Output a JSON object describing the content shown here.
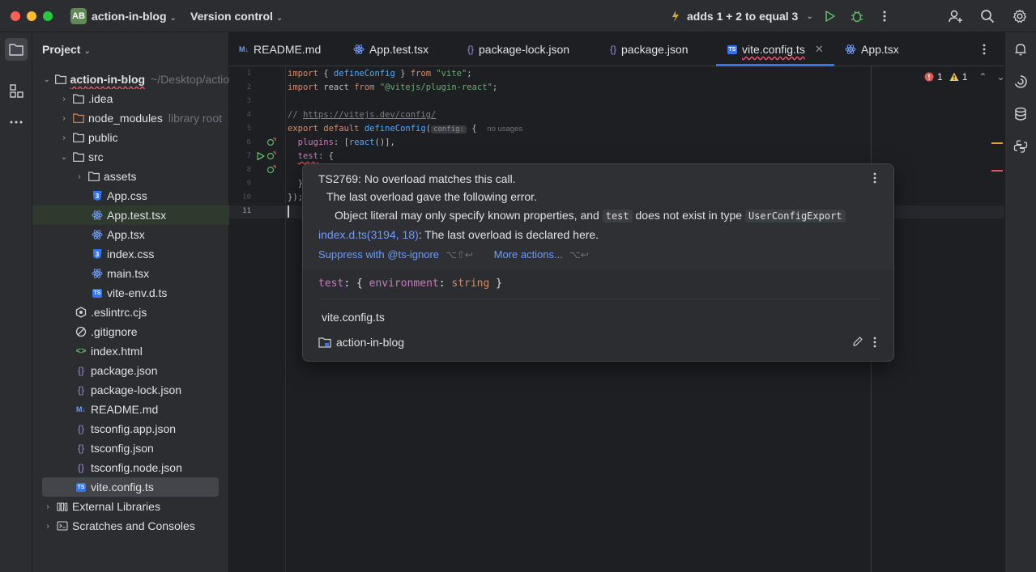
{
  "titlebar": {
    "project_badge": "AB",
    "project_name": "action-in-blog",
    "vcs_label": "Version control",
    "run_config": "adds 1 + 2 to equal 3"
  },
  "project_panel": {
    "title": "Project",
    "root_name": "action-in-blog",
    "root_path": "~/Desktop/actio",
    "items": [
      {
        "label": "action-in-blog"
      },
      {
        "label": ".idea"
      },
      {
        "label": "node_modules",
        "extra": "library root"
      },
      {
        "label": "public"
      },
      {
        "label": "src"
      },
      {
        "label": "assets"
      },
      {
        "label": "App.css"
      },
      {
        "label": "App.test.tsx"
      },
      {
        "label": "App.tsx"
      },
      {
        "label": "index.css"
      },
      {
        "label": "main.tsx"
      },
      {
        "label": "vite-env.d.ts"
      },
      {
        "label": ".eslintrc.cjs"
      },
      {
        "label": ".gitignore"
      },
      {
        "label": "index.html"
      },
      {
        "label": "package.json"
      },
      {
        "label": "package-lock.json"
      },
      {
        "label": "README.md"
      },
      {
        "label": "tsconfig.app.json"
      },
      {
        "label": "tsconfig.json"
      },
      {
        "label": "tsconfig.node.json"
      },
      {
        "label": "vite.config.ts"
      },
      {
        "label": "External Libraries"
      },
      {
        "label": "Scratches and Consoles"
      }
    ]
  },
  "tabs": [
    {
      "label": "README.md"
    },
    {
      "label": "App.test.tsx"
    },
    {
      "label": "package-lock.json"
    },
    {
      "label": "package.json"
    },
    {
      "label": "vite.config.ts"
    },
    {
      "label": "App.tsx"
    }
  ],
  "editor": {
    "line_numbers": [
      "1",
      "2",
      "3",
      "4",
      "5",
      "6",
      "7",
      "8",
      "9",
      "10",
      "11"
    ],
    "code": {
      "l1_kw": "import",
      "l1_a": " { ",
      "l1_fn": "defineConfig",
      "l1_b": " } ",
      "l1_kw2": "from",
      "l1_str": " \"vite\"",
      "l1_c": ";",
      "l2_kw": "import",
      "l2_a": " react ",
      "l2_kw2": "from",
      "l2_str": " \"@vitejs/plugin-react\"",
      "l2_c": ";",
      "l4_cmt": "// ",
      "l4_url": "https://vitejs.dev/config/",
      "l5_kw": "export default",
      "l5_fn": " defineConfig",
      "l5_a": "(",
      "l5_hint": "config:",
      "l5_b": " {",
      "l5_usages": "no usages",
      "l6_prop": "plugins",
      "l6_a": ": [",
      "l6_fn": "react",
      "l6_b": "()],",
      "l7_prop": "test",
      "l7_a": ": {",
      "l9": "}",
      "l10": "});"
    },
    "inspection": {
      "errors": "1",
      "warnings": "1"
    }
  },
  "popup": {
    "error_title": "TS2769: No overload matches this call.",
    "line2": "The last overload gave the following error.",
    "line3_a": "Object literal may only specify known properties, and ",
    "line3_chip1": "test",
    "line3_b": " does not exist in type ",
    "line3_chip2": "UserConfigExport",
    "decl_link": "index.d.ts(3194, 18)",
    "decl_text": ": The last overload is declared here.",
    "suppress_action": "Suppress with @ts-ignore",
    "suppress_shortcut": "⌥⇧↩",
    "more_actions": "More actions...",
    "more_shortcut": "⌥↩",
    "signature_prop": "test",
    "signature_a": ": { ",
    "signature_key": "environment",
    "signature_b": ": ",
    "signature_type": "string",
    "signature_c": " }",
    "file_name": "vite.config.ts",
    "module_name": "action-in-blog"
  }
}
